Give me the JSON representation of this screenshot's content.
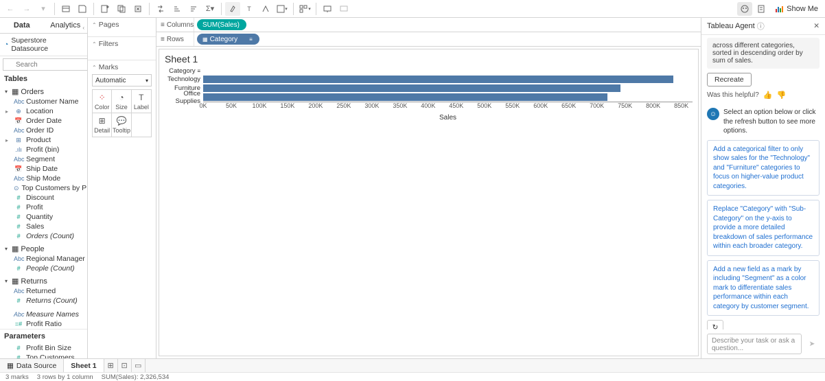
{
  "toolbar": {
    "show_me": "Show Me"
  },
  "data_tabs": {
    "data": "Data",
    "analytics": "Analytics"
  },
  "datasource": "Superstore Datasource",
  "search_placeholder": "Search",
  "tables_label": "Tables",
  "tables": {
    "orders": {
      "name": "Orders",
      "fields": [
        {
          "icon": "Abc",
          "label": "Customer Name",
          "type": "dim"
        },
        {
          "icon": "⊕",
          "label": "Location",
          "type": "dim",
          "expand": true
        },
        {
          "icon": "📅",
          "label": "Order Date",
          "type": "dim"
        },
        {
          "icon": "Abc",
          "label": "Order ID",
          "type": "dim"
        },
        {
          "icon": "⊞",
          "label": "Product",
          "type": "dim",
          "expand": true
        },
        {
          "icon": ".ılı",
          "label": "Profit (bin)",
          "type": "dim"
        },
        {
          "icon": "Abc",
          "label": "Segment",
          "type": "dim"
        },
        {
          "icon": "📅",
          "label": "Ship Date",
          "type": "dim"
        },
        {
          "icon": "Abc",
          "label": "Ship Mode",
          "type": "dim"
        },
        {
          "icon": "⊙",
          "label": "Top Customers by P…",
          "type": "dim"
        },
        {
          "icon": "#",
          "label": "Discount",
          "type": "meas"
        },
        {
          "icon": "#",
          "label": "Profit",
          "type": "meas"
        },
        {
          "icon": "#",
          "label": "Quantity",
          "type": "meas"
        },
        {
          "icon": "#",
          "label": "Sales",
          "type": "meas"
        },
        {
          "icon": "#",
          "label": "Orders (Count)",
          "type": "meas",
          "italic": true
        }
      ]
    },
    "people": {
      "name": "People",
      "fields": [
        {
          "icon": "Abc",
          "label": "Regional Manager",
          "type": "dim"
        },
        {
          "icon": "#",
          "label": "People (Count)",
          "type": "meas",
          "italic": true
        }
      ]
    },
    "returns": {
      "name": "Returns",
      "fields": [
        {
          "icon": "Abc",
          "label": "Returned",
          "type": "dim"
        },
        {
          "icon": "#",
          "label": "Returns (Count)",
          "type": "meas",
          "italic": true
        }
      ]
    }
  },
  "loose_fields": [
    {
      "icon": "Abc",
      "label": "Measure Names",
      "type": "dim",
      "italic": true
    },
    {
      "icon": "=#",
      "label": "Profit Ratio",
      "type": "meas"
    }
  ],
  "parameters_label": "Parameters",
  "parameters": [
    {
      "icon": "#",
      "label": "Profit Bin Size",
      "type": "meas"
    },
    {
      "icon": "#",
      "label": "Top Customers",
      "type": "meas"
    }
  ],
  "shelves": {
    "pages": "Pages",
    "filters": "Filters",
    "marks": "Marks"
  },
  "marks_dropdown": "Automatic",
  "mark_cells": {
    "color": "Color",
    "size": "Size",
    "label": "Label",
    "detail": "Detail",
    "tooltip": "Tooltip"
  },
  "colrow": {
    "columns": "Columns",
    "rows": "Rows"
  },
  "pills": {
    "columns": "SUM(Sales)",
    "rows": "Category"
  },
  "sheet_title": "Sheet 1",
  "chart_header": "Category",
  "chart_axis_label": "Sales",
  "chart_data": {
    "type": "bar",
    "categories": [
      "Technology",
      "Furniture",
      "Office Supplies"
    ],
    "values": [
      836154,
      742000,
      719047
    ],
    "xlabel": "Sales",
    "xlim": [
      0,
      870000
    ],
    "ticks": [
      "0K",
      "50K",
      "100K",
      "150K",
      "200K",
      "250K",
      "300K",
      "350K",
      "400K",
      "450K",
      "500K",
      "550K",
      "600K",
      "650K",
      "700K",
      "750K",
      "800K",
      "850K"
    ]
  },
  "agent": {
    "title": "Tableau Agent",
    "prev_msg": "across different categories, sorted in descending order by sum of sales.",
    "recreate": "Recreate",
    "helpful": "Was this helpful?",
    "select_text": "Select an option below or click the refresh button to see more options.",
    "options": [
      "Add a categorical filter to only show sales for the \"Technology\" and \"Furniture\" categories to focus on higher-value product categories.",
      "Replace \"Category\" with \"Sub-Category\" on the y-axis to provide a more detailed breakdown of sales performance within each broader category.",
      "Add a new field as a mark by including \"Segment\" as a color mark to differentiate sales performance within each category by customer segment."
    ],
    "input_placeholder": "Describe your task or ask a question..."
  },
  "bottom_tabs": {
    "data_source": "Data Source",
    "sheet": "Sheet 1"
  },
  "status": {
    "marks": "3 marks",
    "rows": "3 rows by 1 column",
    "sum": "SUM(Sales): 2,326,534"
  }
}
